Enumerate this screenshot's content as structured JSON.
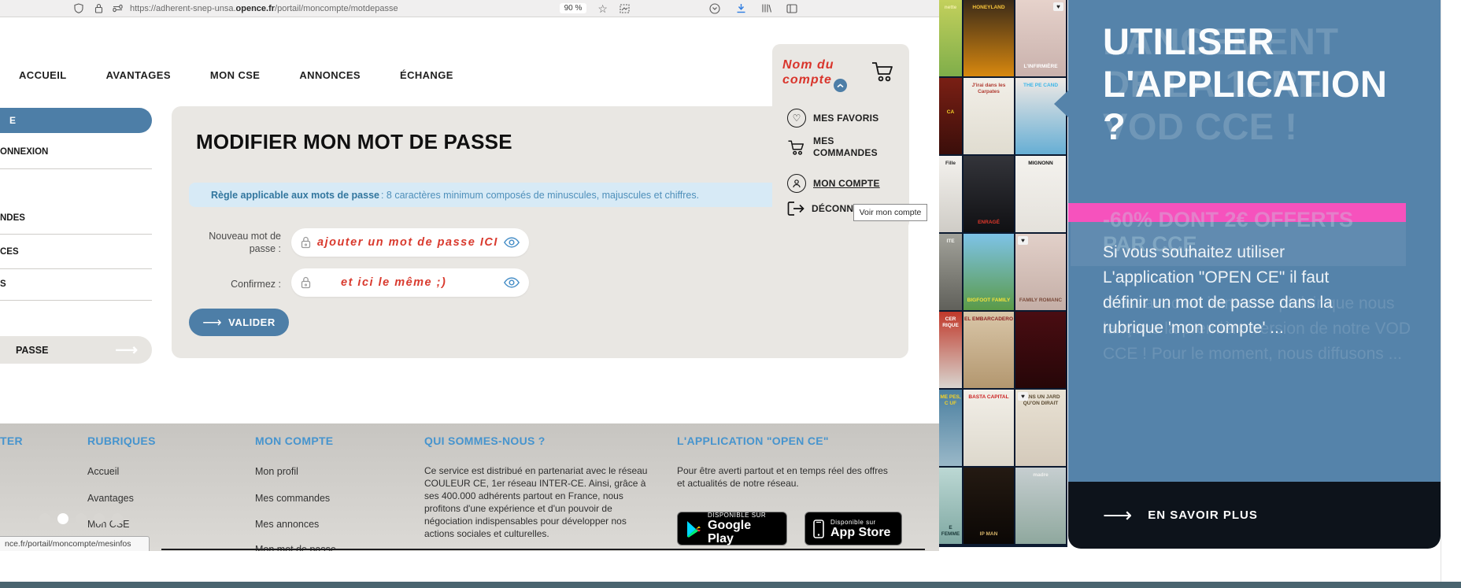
{
  "browser": {
    "url_prefix": "https://adherent-snep-unsa.",
    "url_domain": "opence.fr",
    "url_path": "/portail/moncompte/motdepasse",
    "zoom_level": "90 %"
  },
  "nav": {
    "items": [
      "ACCUEIL",
      "AVANTAGES",
      "MON CSE",
      "ANNONCES",
      "ÉCHANGE"
    ]
  },
  "account_menu": {
    "account_name": "Nom du\ncompte",
    "favorites_label": "MES FAVORIS",
    "orders_label": "MES COMMANDES",
    "account_label": "MON COMPTE",
    "logout_label": "DÉCONN",
    "tooltip": "Voir mon compte"
  },
  "sidebar": {
    "top_item_fragment": "E",
    "items": [
      "ONNEXION",
      "NDES",
      "CES",
      "S"
    ],
    "bottom_item_fragment": "PASSE"
  },
  "password_form": {
    "title": "MODIFIER MON MOT DE PASSE",
    "rule_label": "Règle applicable aux mots de passe",
    "rule_text": ": 8 caractères minimum composés de minuscules, majuscules et chiffres.",
    "new_password_label": "Nouveau mot de passe :",
    "confirm_label": "Confirmez :",
    "new_password_placeholder": "ajouter un mot de passe ICI",
    "confirm_placeholder": "et ici le même ;)",
    "submit_label": "VALIDER"
  },
  "footer": {
    "col0_heading": "TER",
    "rubriques_heading": "RUBRIQUES",
    "rubriques_items": [
      "Accueil",
      "Avantages",
      "Mon CSE"
    ],
    "moncompte_heading": "MON COMPTE",
    "moncompte_items": [
      "Mon profil",
      "Mes commandes",
      "Mes annonces",
      "Mon mot de passe"
    ],
    "about_heading": "QUI SOMMES-NOUS ?",
    "about_text": "Ce service est distribué en partenariat avec le réseau COULEUR CE, 1er réseau INTER-CE. Ainsi, grâce à ses 400.000 adhérents partout en France, nous profitons d'une expérience et d'un pouvoir de négociation indispensables pour développer nos actions sociales et culturelles.",
    "app_heading": "L'APPLICATION \"OPEN CE\"",
    "app_text": "Pour être averti partout et en temps réel des offres et actualités de notre réseau.",
    "google_play_top": "DISPONIBLE SUR",
    "google_play_label": "Google Play",
    "app_store_top": "Disponible sur",
    "app_store_label": "App Store",
    "dots_count": 5,
    "active_dot": 1,
    "status_link": "nce.fr/portail/moncompte/mesinfos"
  },
  "promo_panel": {
    "title": "UTILISER\nL'APPLICATION\n?",
    "ghost_title": "LANCEMENT\nDE LA 1ERE\nVOD CCE !",
    "ghost_subtitle": "-60% DONT 2€ OFFERTS\nPAR CCE",
    "body": "Si vous souhaitez utiliser L'application \"OPEN CE\" il faut définir un mot de passe dans la rubrique 'mon compte' ...",
    "ghost_body": "C'est avec un immense plaisir que nous lançons la première version de notre VOD CCE ! Pour le moment, nous diffusons ...",
    "cta": "EN SAVOIR PLUS",
    "accent_pink": "#f652bd",
    "panel_blue": "#5583aa"
  },
  "posters": {
    "rows": [
      [
        {
          "t": "nette",
          "g": [
            "#c3d05c",
            "#7fae4a"
          ],
          "tc": "#f2eeaa",
          "pos": "top"
        },
        {
          "t": "HONEYLAND",
          "g": [
            "#3a2a18",
            "#d8880f"
          ],
          "tc": "#f5c33b",
          "pos": "top"
        },
        {
          "t": "L'INFIRMIÈRE",
          "g": [
            "#e6d2cb",
            "#c9b1ac"
          ],
          "tc": "#ffffff",
          "pos": "bot",
          "heart": "right"
        }
      ],
      [
        {
          "t": "CA",
          "g": [
            "#7a1f14",
            "#3a0e0a"
          ],
          "tc": "#f5d327",
          "pos": "mid"
        },
        {
          "t": "J'irai dans les Carpates",
          "g": [
            "#f2efe8",
            "#e0dcd0"
          ],
          "tc": "#b03a30",
          "pos": "top"
        },
        {
          "t": "THE PE CAND",
          "g": [
            "#efe9e5",
            "#66aed4"
          ],
          "tc": "#3db6e8",
          "pos": "top"
        }
      ],
      [
        {
          "t": "Fille",
          "g": [
            "#f4f2ee",
            "#cfccc6"
          ],
          "tc": "#2a2a2a",
          "pos": "top"
        },
        {
          "t": "ENRAGÉ",
          "g": [
            "#33343a",
            "#101013"
          ],
          "tc": "#e0372a",
          "pos": "bot"
        },
        {
          "t": "MIGNONN",
          "g": [
            "#f4f2ee",
            "#e4e1db"
          ],
          "tc": "#111111",
          "pos": "top"
        }
      ],
      [
        {
          "t": "ITE",
          "g": [
            "#a2a29a",
            "#60605a"
          ],
          "tc": "#f5f5f0",
          "pos": "top"
        },
        {
          "t": "BIGFOOT FAMILY",
          "g": [
            "#7ec3e8",
            "#5a9a48"
          ],
          "tc": "#f2e23a",
          "pos": "bot"
        },
        {
          "t": "FAMILY ROMANC",
          "g": [
            "#e2d0c9",
            "#c4aea6"
          ],
          "tc": "#7a4a3a",
          "pos": "bot",
          "heart": "left"
        }
      ],
      [
        {
          "t": "CER RIQUE",
          "g": [
            "#c0392b",
            "#d8d5cf"
          ],
          "tc": "#ffffff",
          "pos": "top"
        },
        {
          "t": "EL EMBARCADERO",
          "g": [
            "#d9c6a8",
            "#b3976f"
          ],
          "tc": "#8a2020",
          "pos": "top"
        },
        {
          "t": "",
          "g": [
            "#4a0d12",
            "#260608"
          ],
          "tc": "#c8a23a",
          "pos": "mid"
        }
      ],
      [
        {
          "t": "ME PES, C UF",
          "g": [
            "#4a7fa0",
            "#9ab8c8"
          ],
          "tc": "#f5d327",
          "pos": "top"
        },
        {
          "t": "BASTA CAPITAL",
          "g": [
            "#f2efe8",
            "#ddd8cc"
          ],
          "tc": "#cc2222",
          "pos": "top"
        },
        {
          "t": "DANS UN JARD QU'ON DIRAIT",
          "g": [
            "#e9e2d4",
            "#d4cabb"
          ],
          "tc": "#5a4a30",
          "pos": "top",
          "heart": "left"
        }
      ],
      [
        {
          "t": "E FEMME",
          "g": [
            "#bcd8d4",
            "#7fa8a2"
          ],
          "tc": "#1c3a3a",
          "pos": "bot"
        },
        {
          "t": "IP MAN",
          "g": [
            "#241a12",
            "#0b0705"
          ],
          "tc": "#d8b56a",
          "pos": "bot"
        },
        {
          "t": "madre",
          "g": [
            "#c6ced0",
            "#8fa89e"
          ],
          "tc": "#f0f0ee",
          "pos": "top"
        }
      ]
    ]
  }
}
